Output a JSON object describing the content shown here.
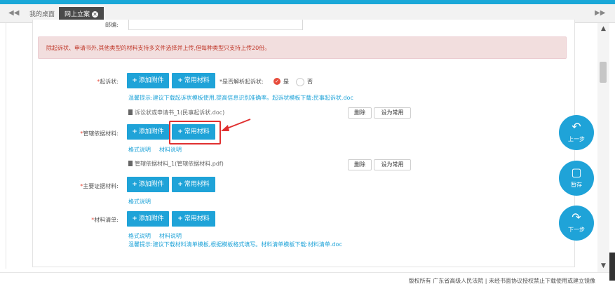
{
  "tabs": {
    "nav_prev": "◀◀",
    "nav_next": "▶▶",
    "items": [
      {
        "label": "我的桌面"
      },
      {
        "label": "网上立案"
      }
    ],
    "close": "✕"
  },
  "form": {
    "top_label": "邮编:",
    "alert_text": "除起诉状、申请书外,其他类型的材料支持多文件选择并上传,但每种类型只支持上传20份。",
    "add_attach": "添加附件",
    "common_material": "常用材料",
    "sections": {
      "complaint": {
        "label": "起诉状:",
        "parse_label": "*是否解析起诉状:",
        "yes": "是",
        "no": "否",
        "tip": "温馨提示:建议下载起诉状模板使用,提高信息识别准确率。起诉状模板下载:民事起诉状.doc",
        "file": "诉讼状或申请书_1(民事起诉状.doc)",
        "delete": "删除",
        "set_common": "设为常用"
      },
      "jurisdiction": {
        "label": "管辖依据材料:",
        "link1": "格式说明",
        "link2": "材料说明",
        "file": "管辖依据材料_1(管辖依据材料.pdf)",
        "delete": "删除",
        "set_common": "设为常用"
      },
      "evidence": {
        "label": "主要证据材料:",
        "link1": "格式说明"
      },
      "list": {
        "label": "材料清单:",
        "link1": "格式说明",
        "link2": "材料说明",
        "tip": "温馨提示:建议下载材料清单模板,根据模板格式填写。材料清单模板下载:材料清单.doc"
      }
    }
  },
  "fabs": {
    "prev": "上一步",
    "save": "暂存",
    "next": "下一步"
  },
  "footer": {
    "text": "版权所有 广东省高级人民法院 | 未经书面协议授权禁止下载使用或建立镜像"
  },
  "colors": {
    "accent": "#1fa3d8",
    "alert_bg": "#f2dede",
    "alert_text": "#c0392b",
    "highlight": "#e03030"
  }
}
